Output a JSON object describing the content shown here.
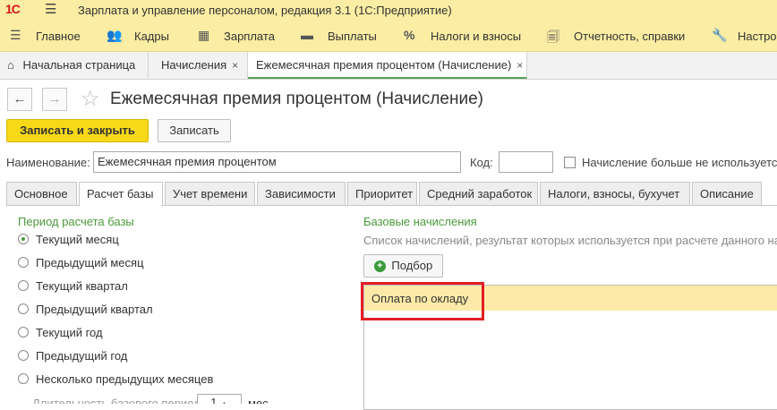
{
  "app": {
    "logo": "1С",
    "title": "Зарплата и управление персоналом, редакция 3.1  (1С:Предприятие)"
  },
  "menu": {
    "items": [
      {
        "label": "Главное",
        "icon": "hamburger-icon"
      },
      {
        "label": "Кадры",
        "icon": "people-icon"
      },
      {
        "label": "Зарплата",
        "icon": "calculator-icon"
      },
      {
        "label": "Выплаты",
        "icon": "wallet-icon"
      },
      {
        "label": "Налоги и взносы",
        "icon": "percent-icon"
      },
      {
        "label": "Отчетность, справки",
        "icon": "document-icon"
      },
      {
        "label": "Настро",
        "icon": "wrench-icon"
      }
    ]
  },
  "open_tabs": [
    {
      "label": "Начальная страница",
      "icon": "home-icon"
    },
    {
      "label": "Начисления",
      "close": "×"
    },
    {
      "label": "Ежемесячная премия процентом (Начисление)",
      "close": "×"
    }
  ],
  "form": {
    "title": "Ежемесячная премия процентом (Начисление)",
    "save_close_label": "Записать и закрыть",
    "save_label": "Записать",
    "name_label": "Наименование:",
    "name_value": "Ежемесячная премия процентом",
    "code_label": "Код:",
    "code_value": "",
    "unused_label": "Начисление больше не используется",
    "unused_checked": false
  },
  "form_tabs": [
    "Основное",
    "Расчет базы",
    "Учет времени",
    "Зависимости",
    "Приоритет",
    "Средний заработок",
    "Налоги, взносы, бухучет",
    "Описание"
  ],
  "active_tab": "Расчет базы",
  "period": {
    "title": "Период расчета базы",
    "options": [
      "Текущий месяц",
      "Предыдущий месяц",
      "Текущий квартал",
      "Предыдущий квартал",
      "Текущий год",
      "Предыдущий год",
      "Несколько предыдущих месяцев"
    ],
    "selected": "Текущий месяц",
    "duration_label": "Длительность базового периода",
    "duration_value": "1",
    "duration_unit": "мес."
  },
  "base": {
    "title": "Базовые начисления",
    "description": "Список начислений, результат которых используется при расчете данного на",
    "add_button_label": "Подбор",
    "items": [
      "Оплата по окладу"
    ]
  },
  "colors": {
    "accent_yellow": "#f7d918",
    "header_bg": "#fbeda3",
    "green_label": "#4a9a3a",
    "highlight_red": "#e41e24"
  }
}
